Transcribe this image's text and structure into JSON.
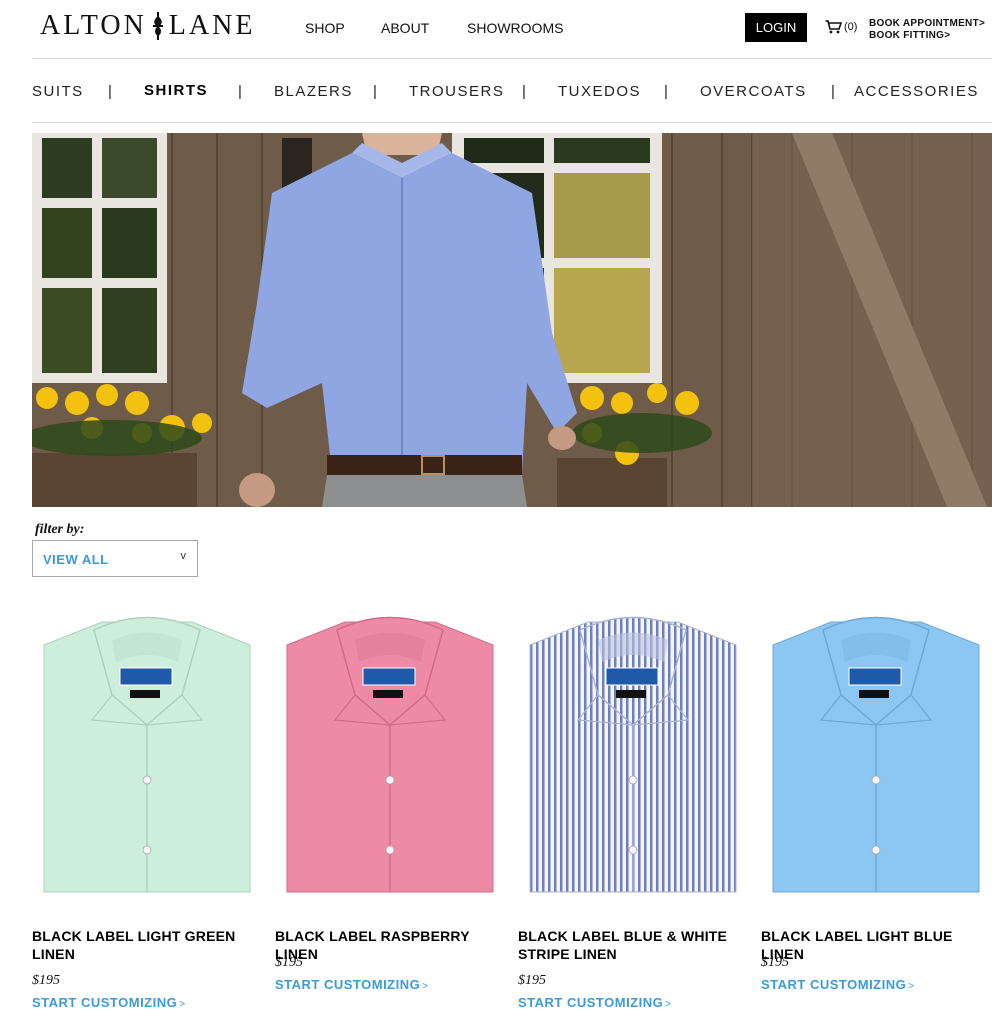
{
  "brand": {
    "logo_left": "ALTON",
    "logo_right": "LANE"
  },
  "topnav": {
    "shop": "SHOP",
    "about": "ABOUT",
    "showrooms": "SHOWROOMS"
  },
  "header": {
    "login": "LOGIN",
    "cart_count": "(0)",
    "book_appointment": "BOOK APPOINTMENT",
    "book_fitting": "BOOK FITTING",
    "arrow": ">"
  },
  "categories": [
    "SUITS",
    "SHIRTS",
    "BLAZERS",
    "TROUSERS",
    "TUXEDOS",
    "OVERCOATS",
    "ACCESSORIES"
  ],
  "active_category": "SHIRTS",
  "separator": "|",
  "filter": {
    "label": "filter by:",
    "selected": "VIEW ALL",
    "chevron": "v"
  },
  "products": [
    {
      "name": "BLACK LABEL LIGHT GREEN LINEN",
      "price": "$195",
      "cta": "START CUSTOMIZING",
      "cta_arrow": ">",
      "color": "#cdeedb",
      "pattern": "solid"
    },
    {
      "name": "BLACK LABEL RASPBERRY LINEN",
      "price": "$195",
      "cta": "START CUSTOMIZING",
      "cta_arrow": ">",
      "color": "#ee8aa6",
      "pattern": "solid"
    },
    {
      "name": "BLACK LABEL BLUE & WHITE STRIPE LINEN",
      "price": "$195",
      "cta": "START CUSTOMIZING",
      "cta_arrow": ">",
      "color": "#c9d2ea",
      "pattern": "stripe"
    },
    {
      "name": "BLACK LABEL LIGHT BLUE LINEN",
      "price": "$195",
      "cta": "START CUSTOMIZING",
      "cta_arrow": ">",
      "color": "#8cc7f3",
      "pattern": "solid"
    }
  ],
  "colors": {
    "accent": "#3a9bdc",
    "login_bg": "#000000",
    "rule": "#d8d8d8"
  }
}
